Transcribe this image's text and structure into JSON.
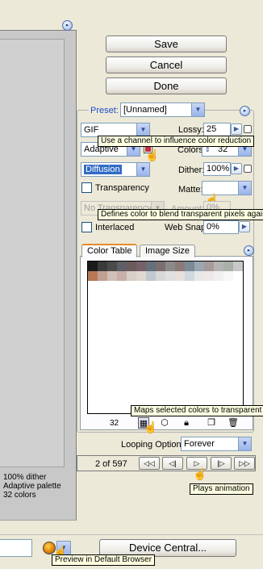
{
  "buttons": {
    "save": "Save",
    "cancel": "Cancel",
    "done": "Done",
    "device_central": "Device Central..."
  },
  "preset": {
    "label": "Preset:",
    "value": "[Unnamed]"
  },
  "format": {
    "value": "GIF"
  },
  "lossy": {
    "label": "Lossy:",
    "value": "25"
  },
  "reduction": {
    "value": "Adaptive"
  },
  "colors": {
    "label": "Colors:",
    "value": "32"
  },
  "dither_algo": {
    "value": "Diffusion"
  },
  "dither": {
    "label": "Dither:",
    "value": "100%"
  },
  "transparency": {
    "label": "Transparency",
    "checked": false
  },
  "matte": {
    "label": "Matte:",
    "value": ""
  },
  "transparency_dither": {
    "value": "No Transparency"
  },
  "amount": {
    "label": "Amount:",
    "value": "0%"
  },
  "interlaced": {
    "label": "Interlaced",
    "checked": false
  },
  "web_snap": {
    "label": "Web Snap:",
    "value": "0%"
  },
  "tabs": {
    "color_table": "Color Table",
    "image_size": "Image Size"
  },
  "color_table": {
    "count": "32",
    "colors": [
      "#1a1a1a",
      "#3a3a3a",
      "#4a4a4a",
      "#5e5e66",
      "#6a5a5a",
      "#76606a",
      "#66707a",
      "#7a6e6e",
      "#8a8a8a",
      "#8c7a7a",
      "#7c8a96",
      "#9aa6b0",
      "#a69a9a",
      "#b4b4b4",
      "#a8b0a8",
      "#c8c8c8",
      "#b87856",
      "#c0a090",
      "#d0c0b8",
      "#c8b0a8",
      "#d8d0c8",
      "#e0d8d0",
      "#c0c8d0",
      "#d8d8d8",
      "#e0e0e0",
      "#e8e0d8",
      "#d0d8e0",
      "#e8e8e8",
      "#f0e8e8",
      "#f0f0f0",
      "#f8f8f8",
      "#ffffff"
    ]
  },
  "tooltips": {
    "channel": "Use a channel to influence color reduction",
    "matte": "Defines color to blend transparent pixels against",
    "transparent": "Maps selected colors to transparent",
    "play": "Plays animation",
    "browser": "Preview in Default Browser"
  },
  "looping": {
    "label": "Looping Options:",
    "value": "Forever"
  },
  "animation": {
    "frame": "2 of 597"
  },
  "preview_info": {
    "line1": "100% dither",
    "line2": "Adaptive palette",
    "line3": "32 colors"
  }
}
